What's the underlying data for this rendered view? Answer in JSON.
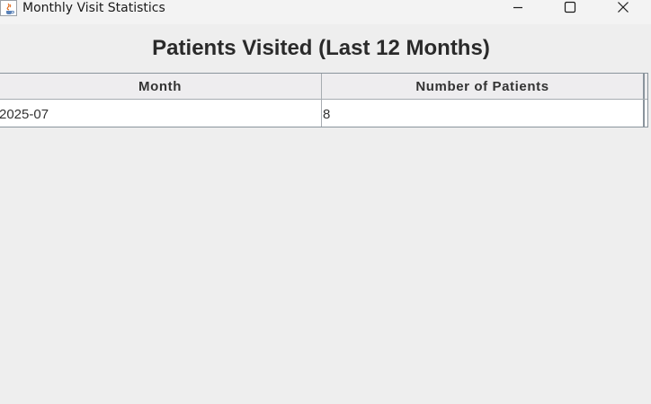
{
  "window": {
    "title": "Monthly Visit Statistics",
    "app_icon": "java-icon",
    "controls": {
      "minimize": "minimize-icon",
      "maximize": "maximize-icon",
      "close": "close-icon"
    }
  },
  "main": {
    "heading": "Patients Visited (Last 12 Months)",
    "table": {
      "columns": [
        "Month",
        "Number of Patients"
      ],
      "rows": [
        [
          "2025-07",
          "8"
        ]
      ]
    }
  },
  "colors": {
    "background": "#eeeeee",
    "header_bg": "#eeedef",
    "border": "#8a949c",
    "text": "#333333"
  }
}
